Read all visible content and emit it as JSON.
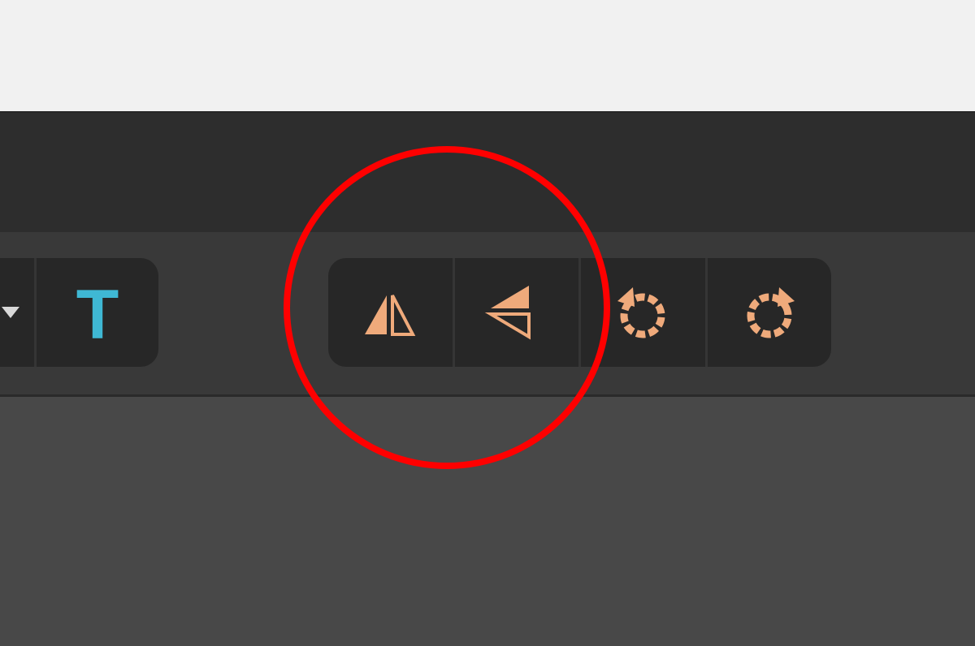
{
  "colors": {
    "icon_accent": "#efaa7b",
    "text_tool_accent": "#3fb8d4",
    "highlight": "#ff0000"
  },
  "toolbar": {
    "text_tool": {
      "glyph": "T",
      "icon": "text-tool-icon"
    },
    "dropdown": {
      "icon": "chevron-down-icon"
    },
    "transform_buttons": [
      {
        "name": "flip-horizontal",
        "icon": "flip-horizontal-icon"
      },
      {
        "name": "flip-vertical",
        "icon": "flip-vertical-icon"
      },
      {
        "name": "rotate-left",
        "icon": "rotate-counterclockwise-icon"
      },
      {
        "name": "rotate-right",
        "icon": "rotate-clockwise-icon"
      }
    ]
  },
  "annotation": {
    "shape": "circle",
    "target": "flip buttons"
  }
}
